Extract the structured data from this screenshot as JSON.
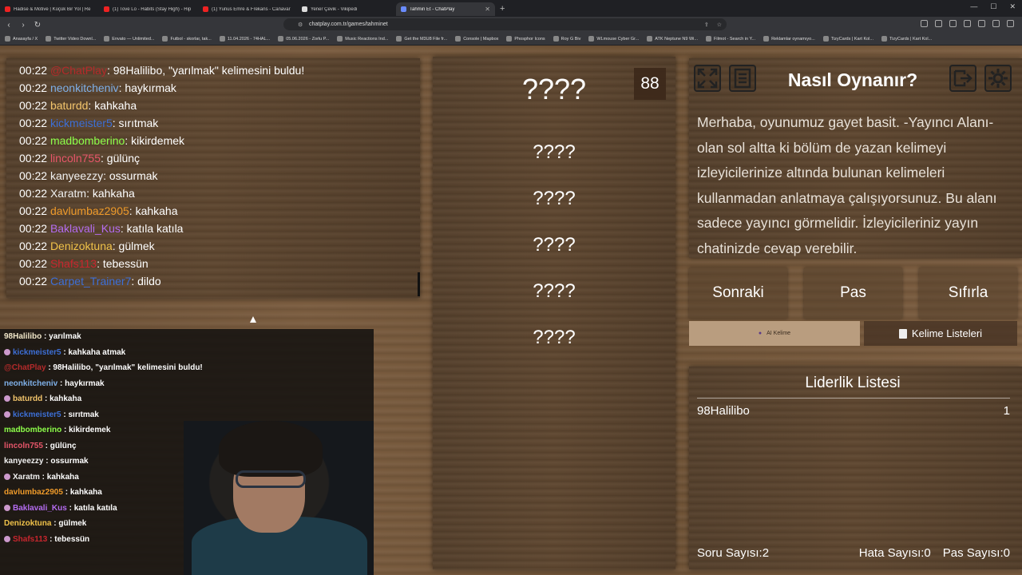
{
  "browser": {
    "tabs": [
      {
        "title": "Hadise & Motive | Küçük Bir Yol | Re",
        "fav": "youtube"
      },
      {
        "title": "(1) Tove Lo - Habits (Stay High) - Hip",
        "fav": "youtube"
      },
      {
        "title": "(1) Yunus Emre & Frekans - Canavar",
        "fav": "youtube"
      },
      {
        "title": "Yener Çevik - Vikipedi",
        "fav": "wikipedia"
      },
      {
        "title": "Tahmin Et - ChatPlay",
        "fav": "chatplay",
        "active": true
      }
    ],
    "url": "chatplay.com.tr/games/tahminet",
    "bookmarks": [
      "Anasayfa / X",
      "Twitter Video Downl...",
      "Envato — Unlimited...",
      "Futbol - skorlar, tak...",
      "11.04.2026 - 74HAL...",
      "05.06.2026 - Zorlu P...",
      "Music Reactions Ind...",
      "Get the M3U8 File fr...",
      "Console | Mapbox",
      "Phosphor Icons",
      "Roy G Biv",
      "WLmouse Cyber Gr...",
      "ATK Neptune N9 Wi...",
      "Filmot - Search in Y...",
      "Reklamlar oynamıyo...",
      "TizyCards | Kart Kol...",
      "TizyCards | Kart Kol..."
    ]
  },
  "chatlog": [
    {
      "time": "00:22",
      "user": "@ChatPlay",
      "color": "#b42a2a",
      "msg": ": 98Halilibo, \"yarılmak\" kelimesini buldu!"
    },
    {
      "time": "00:22",
      "user": "neonkitcheniv",
      "color": "#7fb0e8",
      "msg": ": haykırmak"
    },
    {
      "time": "00:22",
      "user": "baturdd",
      "color": "#f2c46b",
      "msg": ": kahkaha"
    },
    {
      "time": "00:22",
      "user": "kickmeister5",
      "color": "#3d6fd6",
      "msg": ": sırıtmak"
    },
    {
      "time": "00:22",
      "user": "madbomberino",
      "color": "#8dff4a",
      "msg": ": kikirdemek"
    },
    {
      "time": "00:22",
      "user": "lincoln755",
      "color": "#e8566a",
      "msg": ": gülünç"
    },
    {
      "time": "00:22",
      "user": "kanyeezzy",
      "color": "#f0f0f0",
      "msg": ": ossurmak"
    },
    {
      "time": "00:22",
      "user": "Xaratm",
      "color": "#f0f0f0",
      "msg": ": kahkaha"
    },
    {
      "time": "00:22",
      "user": "davlumbaz2905",
      "color": "#ee9a2a",
      "msg": ": kahkaha"
    },
    {
      "time": "00:22",
      "user": "Baklavali_Kus",
      "color": "#b46cf0",
      "msg": ": katıla katıla"
    },
    {
      "time": "00:22",
      "user": "Denizoktuna",
      "color": "#f0c24a",
      "msg": ": gülmek"
    },
    {
      "time": "00:22",
      "user": "Shafs113",
      "color": "#c8262e",
      "msg": ": tebessün"
    },
    {
      "time": "00:22",
      "user": "Carpet_Trainer7",
      "color": "#3d6fd6",
      "msg": ": dildo"
    }
  ],
  "game": {
    "score": "88",
    "main_word": "????",
    "hidden_words": [
      "????",
      "????",
      "????",
      "????",
      "????"
    ]
  },
  "info": {
    "title": "Nasıl Oynanır?",
    "text": "Merhaba, oyunumuz gayet basit. -Yayıncı Alanı- olan sol altta ki bölüm de yazan kelimeyi izleyicilerinize altında bulunan kelimeleri kullanmadan anlatmaya çalışıyorsunuz. Bu alanı sadece yayıncı görmelidir. İzleyicileriniz yayın chatinizde cevap verebilir."
  },
  "buttons": {
    "next": "Sonraki",
    "pass": "Pas",
    "reset": "Sıfırla",
    "ai_word": "AI Kelime",
    "word_lists": "Kelime Listeleri"
  },
  "leaderboard": {
    "title": "Liderlik Listesi",
    "rows": [
      {
        "name": "98Halilibo",
        "score": "1"
      }
    ],
    "question_count": "Soru Sayısı:2",
    "error_count": "Hata Sayısı:0",
    "pass_count": "Pas Sayısı:0"
  },
  "stream_chat": [
    {
      "user": "98Halilibo",
      "color": "#f0e6c8",
      "msg": " : yarılmak",
      "badge": false
    },
    {
      "user": "kickmeister5",
      "color": "#3d6fd6",
      "msg": " : kahkaha atmak",
      "badge": true
    },
    {
      "user": "@ChatPlay",
      "color": "#b42a2a",
      "msg": " : 98Halilibo, \"yarılmak\" kelimesini buldu!",
      "badge": false
    },
    {
      "user": "neonkitcheniv",
      "color": "#7fb0e8",
      "msg": " : haykırmak",
      "badge": false
    },
    {
      "user": "baturdd",
      "color": "#f2c46b",
      "msg": " : kahkaha",
      "badge": true
    },
    {
      "user": "kickmeister5",
      "color": "#3d6fd6",
      "msg": " : sırıtmak",
      "badge": true
    },
    {
      "user": "madbomberino",
      "color": "#8dff4a",
      "msg": " : kikirdemek",
      "badge": false
    },
    {
      "user": "lincoln755",
      "color": "#e8566a",
      "msg": " : gülünç",
      "badge": false
    },
    {
      "user": "kanyeezzy",
      "color": "#f0f0f0",
      "msg": " : ossurmak",
      "badge": false
    },
    {
      "user": "Xaratm",
      "color": "#f0f0f0",
      "msg": " : kahkaha",
      "badge": true
    },
    {
      "user": "davlumbaz2905",
      "color": "#ee9a2a",
      "msg": " : kahkaha",
      "badge": false
    },
    {
      "user": "Baklavali_Kus",
      "color": "#b46cf0",
      "msg": " : katıla katıla",
      "badge": true
    },
    {
      "user": "Denizoktuna",
      "color": "#f0c24a",
      "msg": " : gülmek",
      "badge": false
    },
    {
      "user": "Shafs113",
      "color": "#c8262e",
      "msg": " : tebessün",
      "badge": true
    }
  ]
}
